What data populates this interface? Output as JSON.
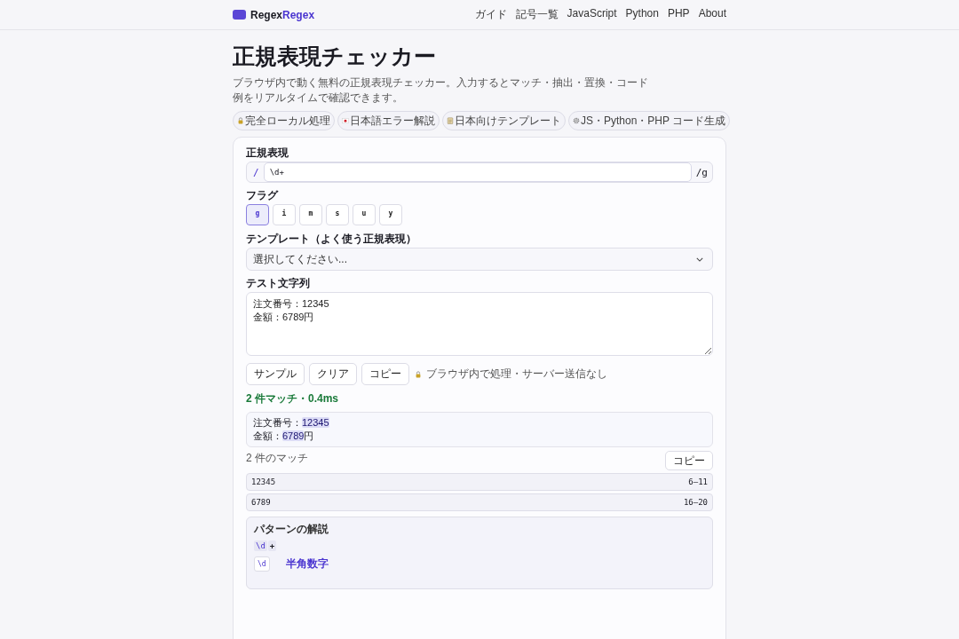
{
  "header": {
    "logo_text": "Regex",
    "logo_accent": "Regex",
    "nav": [
      "ガイド",
      "記号一覧",
      "JavaScript",
      "Python",
      "PHP",
      "About"
    ]
  },
  "title": "正規表現チェッカー",
  "lead": "ブラウザ内で動く無料の正規表現チェッカー。入力するとマッチ・抽出・置換・コード例をリアルタイムで確認できます。",
  "chips": [
    {
      "kind": "lock",
      "label": "完全ローカル処理"
    },
    {
      "kind": "flag",
      "label": "日本語エラー解説"
    },
    {
      "kind": "note",
      "label": "日本向けテンプレート"
    },
    {
      "kind": "gear",
      "label": "JS・Python・PHP コード生成"
    }
  ],
  "regex": {
    "label": "正規表現",
    "open": "/",
    "value": "\\d+",
    "close": "/g"
  },
  "flags": {
    "label": "フラグ",
    "items": [
      {
        "label": "g",
        "selected": true
      },
      {
        "label": "i",
        "selected": false
      },
      {
        "label": "m",
        "selected": false
      },
      {
        "label": "s",
        "selected": false
      },
      {
        "label": "u",
        "selected": false
      },
      {
        "label": "y",
        "selected": false
      }
    ]
  },
  "template": {
    "label": "テンプレート（よく使う正規表現）",
    "placeholder": "選択してください..."
  },
  "test": {
    "label": "テスト文字列",
    "value": "注文番号：12345\n金額：6789円"
  },
  "actions": [
    "サンプル",
    "クリア",
    "コピー"
  ],
  "privacy_note": "ブラウザ内で処理・サーバー送信なし",
  "status": "2 件マッチ・0.4ms",
  "preview": [
    [
      {
        "text": "注文番号：",
        "match": false
      },
      {
        "text": "12345",
        "match": true
      }
    ],
    [
      {
        "text": "金額：",
        "match": false
      },
      {
        "text": "6789",
        "match": true
      },
      {
        "text": "円",
        "match": false
      }
    ]
  ],
  "matches": {
    "count": "2 件のマッチ",
    "copy": "コピー",
    "rows": [
      {
        "value": "12345",
        "range": "6–11"
      },
      {
        "value": "6789",
        "range": "16–20"
      }
    ]
  },
  "explain": {
    "title": "パターンの解説",
    "tokens": [
      {
        "text": "\\d",
        "kind": "class"
      },
      {
        "text": "+",
        "kind": "quant"
      }
    ],
    "items": [
      {
        "token": "\\d",
        "name": "半角数字"
      }
    ]
  }
}
